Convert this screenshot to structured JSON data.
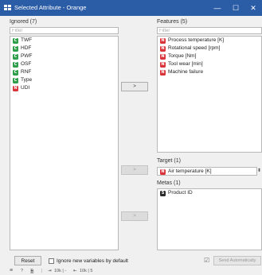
{
  "window": {
    "title": "Selected Attribute - Orange",
    "minimize_glyph": "—",
    "maximize_glyph": "☐",
    "close_glyph": "✕"
  },
  "ignored": {
    "label": "Ignored (7)",
    "filter_placeholder": "Filter",
    "items": [
      {
        "name": "TWF",
        "badge": "C",
        "color": "#2e9e4a"
      },
      {
        "name": "HDF",
        "badge": "C",
        "color": "#2e9e4a"
      },
      {
        "name": "PWF",
        "badge": "C",
        "color": "#2e9e4a"
      },
      {
        "name": "OSF",
        "badge": "C",
        "color": "#2e9e4a"
      },
      {
        "name": "RNF",
        "badge": "C",
        "color": "#2e9e4a"
      },
      {
        "name": "Type",
        "badge": "C",
        "color": "#2e9e4a"
      },
      {
        "name": "UDI",
        "badge": "N",
        "color": "#d9343a"
      }
    ]
  },
  "features": {
    "label": "Features (5)",
    "filter_placeholder": "Filter",
    "items": [
      {
        "name": "Process temperature [K]",
        "badge": "N",
        "color": "#d9343a"
      },
      {
        "name": "Rotational speed [rpm]",
        "badge": "N",
        "color": "#d9343a"
      },
      {
        "name": "Torque [Nm]",
        "badge": "N",
        "color": "#d9343a"
      },
      {
        "name": "Tool wear [min]",
        "badge": "N",
        "color": "#d9343a"
      },
      {
        "name": "Machine failure",
        "badge": "N",
        "color": "#d9343a"
      }
    ]
  },
  "target": {
    "label": "Target (1)",
    "value": "Air temperature [K]",
    "badge": "N",
    "color": "#d9343a",
    "spin_glyph": "⬍"
  },
  "metas": {
    "label": "Metas (1)",
    "items": [
      {
        "name": "Product ID",
        "badge": "S",
        "color": "#2b2b2b"
      }
    ]
  },
  "buttons": {
    "move_features": ">",
    "move_target": ">",
    "move_metas": ">",
    "reset": "Reset",
    "ignore_new_label": "Ignore new variables by default",
    "send_auto": "Send Automatically",
    "send_check": "☑"
  },
  "statusbar": {
    "menu": "≡",
    "help": "?",
    "doc": "🗎",
    "input_icon": "⇥",
    "input_text": "10k | -",
    "output_icon": "⇤",
    "output_text": "10k | 5"
  }
}
